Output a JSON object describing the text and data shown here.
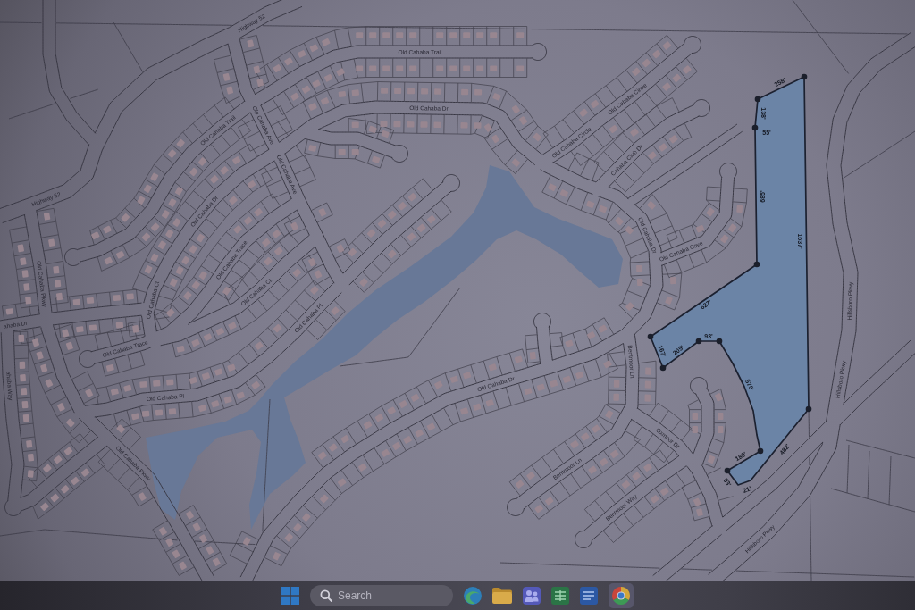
{
  "map": {
    "street_labels": [
      "Highway 52",
      "Highway 52",
      "Old Cahaba Trail",
      "Old Cahaba Dr",
      "Old Cahaba Trail",
      "Old Cahaba Ave",
      "Old Cahaba Ave",
      "Old Cahaba Dr",
      "Old Cahaba Trace",
      "Old Cahaba Ct",
      "Old Cahaba Ct",
      "Old Cahaba Pl",
      "Old Cahaba Pkwy",
      "ahaba Dr",
      "Old Cahaba Trace",
      "Old Cahaba Pl",
      "ahaba Way",
      "Old Cahaba Pkwy",
      "Old Cahaba Circle",
      "Old Cahaba Circle",
      "Cahaba Club Dr",
      "Old Cahaba Dr",
      "Old Cahaba Cove",
      "Old Cahaba Dr",
      "Bentmoor Ln",
      "Bentmoor Ln",
      "Bentmoor Way",
      "Oxmoor Dr",
      "Hillsboro Pkwy",
      "Hillsboro Pkwy",
      "Hillsboro Pkwy"
    ],
    "parcel": {
      "dimension_labels": [
        "258'",
        "138'",
        "55'",
        "685'",
        "1637'",
        "627'",
        "167'",
        "205'",
        "93'",
        "570'",
        "482'",
        "180'",
        "93'",
        "21'"
      ]
    }
  },
  "taskbar": {
    "search": {
      "placeholder": "Search"
    }
  }
}
